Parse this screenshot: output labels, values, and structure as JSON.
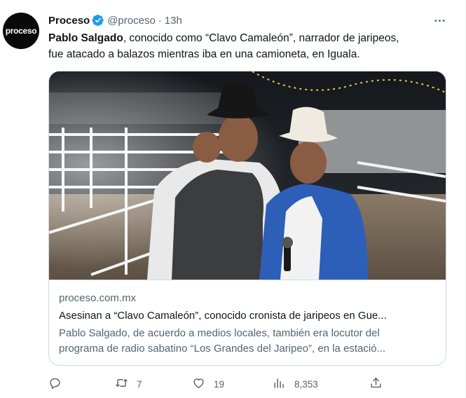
{
  "author": {
    "display_name": "Proceso",
    "handle": "@proceso",
    "time": "13h",
    "avatar_text": "proceso",
    "verified_color": "#1d9bf0"
  },
  "tweet": {
    "lead_bold": "Pablo Salgado",
    "text_line1_rest": ", conocido como “Clavo Camaleón”, narrador de jaripeos,",
    "text_line2": "fue atacado a balazos mientras iba en una camioneta, en Iguala."
  },
  "card": {
    "domain": "proceso.com.mx",
    "title": "Asesinan a “Clavo Camaleón”, conocido cronista de jaripeos en Gue...",
    "desc_line1": "Pablo Salgado, de acuerdo a medios locales, también era locutor del",
    "desc_line2": "programa de radio sabatino “Los Grandes del Jaripeo”, en la estació..."
  },
  "actions": {
    "replies": "",
    "retweets": "7",
    "likes": "19",
    "views": "8,353"
  },
  "colors": {
    "text": "#0f1419",
    "secondary": "#536471",
    "border": "#cfd9de",
    "accent": "#1d9bf0"
  },
  "icons": [
    "verified-badge-icon",
    "more-icon",
    "reply-icon",
    "retweet-icon",
    "like-icon",
    "views-icon",
    "share-icon"
  ]
}
